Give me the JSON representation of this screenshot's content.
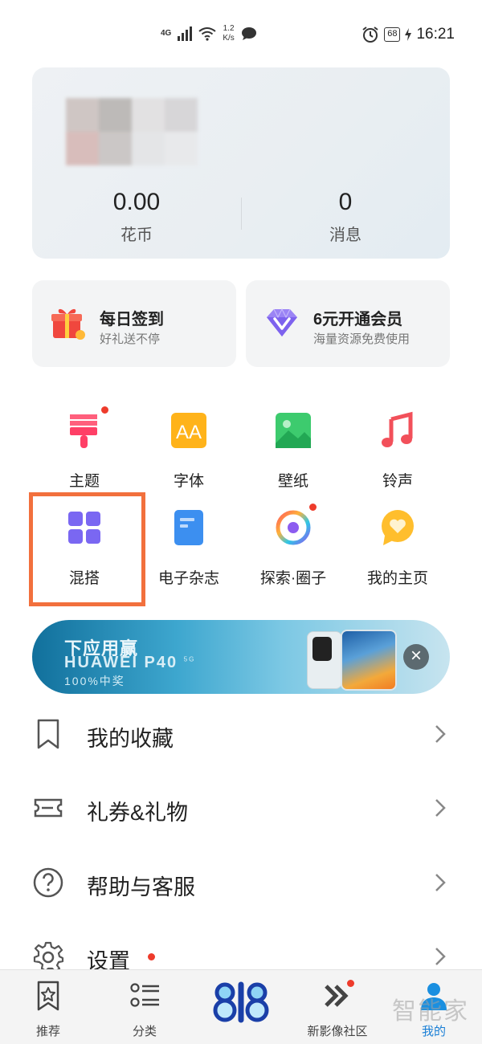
{
  "status_bar": {
    "network": "4G",
    "speed_value": "1.2",
    "speed_unit": "K/s",
    "battery": "68",
    "time": "16:21"
  },
  "profile": {
    "coins_value": "0.00",
    "coins_label": "花币",
    "messages_value": "0",
    "messages_label": "消息"
  },
  "promos": {
    "checkin_title": "每日签到",
    "checkin_sub": "好礼送不停",
    "vip_title": "6元开通会员",
    "vip_sub": "海量资源免费使用"
  },
  "grid": {
    "theme": "主题",
    "font": "字体",
    "wallpaper": "壁纸",
    "ringtone": "铃声",
    "mix": "混搭",
    "magazine": "电子杂志",
    "explore": "探索·圈子",
    "homepage": "我的主页"
  },
  "banner": {
    "line1": "下应用赢",
    "line2": "HUAWEI P40",
    "line2_sup": "5G",
    "line3": "100%中奖",
    "close": "×"
  },
  "menu": {
    "favorites": "我的收藏",
    "coupons": "礼券&礼物",
    "help": "帮助与客服",
    "settings": "设置"
  },
  "bottom_nav": {
    "recommend": "推荐",
    "category": "分类",
    "community": "新影像社区",
    "mine": "我的"
  },
  "watermark": "智能家",
  "colors": {
    "accent_blue": "#1a7fd6",
    "highlight_orange": "#f2703d",
    "badge_red": "#ee3b2b"
  }
}
